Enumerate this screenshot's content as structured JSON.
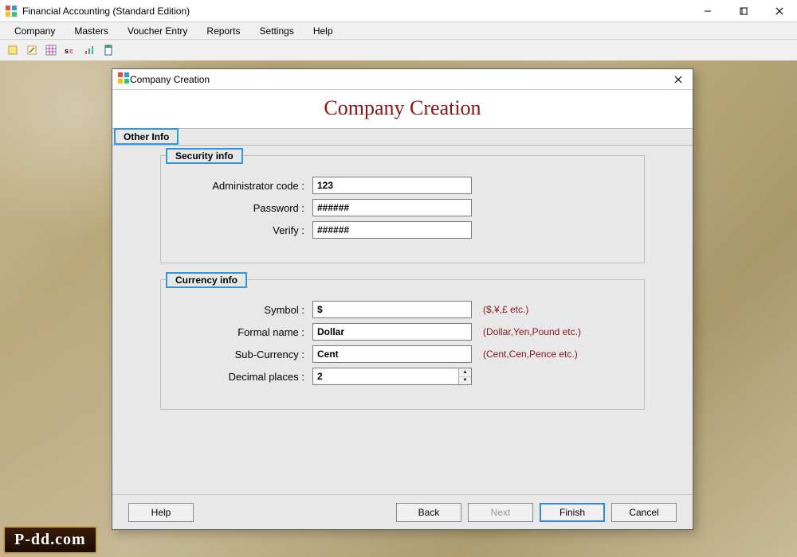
{
  "app": {
    "title": "Financial Accounting (Standard Edition)"
  },
  "menubar": [
    "Company",
    "Masters",
    "Voucher Entry",
    "Reports",
    "Settings",
    "Help"
  ],
  "toolbar_icons": [
    "new-icon",
    "edit-icon",
    "grid-icon",
    "swap-icon",
    "chart-icon",
    "doc-icon"
  ],
  "dialog": {
    "title": "Company Creation",
    "heading": "Company Creation",
    "tab": "Other Info",
    "security": {
      "legend": "Security info",
      "admin_code_label": "Administrator code :",
      "admin_code_value": "123",
      "password_label": "Password :",
      "password_value": "######",
      "verify_label": "Verify :",
      "verify_value": "######"
    },
    "currency": {
      "legend": "Currency info",
      "symbol_label": "Symbol :",
      "symbol_value": "$",
      "symbol_hint": "($,¥,£ etc.)",
      "formal_label": "Formal name :",
      "formal_value": "Dollar",
      "formal_hint": "(Dollar,Yen,Pound etc.)",
      "sub_label": "Sub-Currency :",
      "sub_value": "Cent",
      "sub_hint": "(Cent,Cen,Pence etc.)",
      "decimal_label": "Decimal places :",
      "decimal_value": "2"
    },
    "buttons": {
      "help": "Help",
      "back": "Back",
      "next": "Next",
      "finish": "Finish",
      "cancel": "Cancel"
    }
  },
  "watermark": "P-dd.com"
}
